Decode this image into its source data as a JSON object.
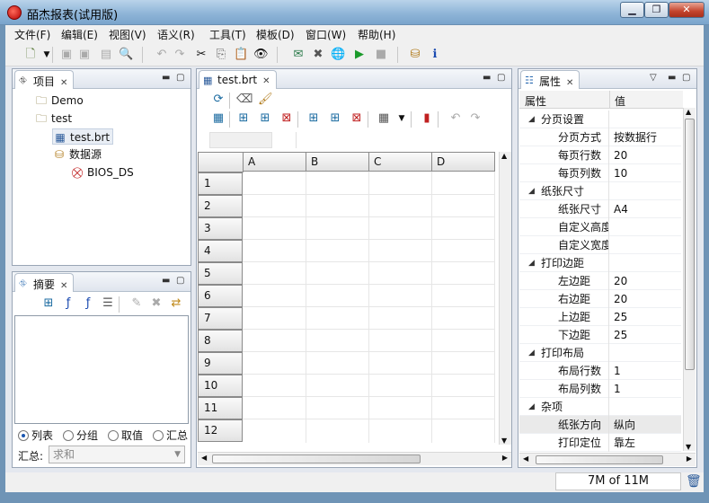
{
  "app": {
    "title": "皕杰报表(试用版)"
  },
  "menu": [
    "文件(F)",
    "编辑(E)",
    "视图(V)",
    "语义(R)",
    "工具(T)",
    "模板(D)",
    "窗口(W)",
    "帮助(H)"
  ],
  "project_panel": {
    "tab": "项目",
    "tree": [
      {
        "label": "Demo",
        "icon": "folder-icon"
      },
      {
        "label": "test",
        "icon": "folder-icon"
      },
      {
        "label": "test.brt",
        "icon": "report-file-icon"
      },
      {
        "label": "数据源",
        "icon": "datasource-icon"
      },
      {
        "label": "BIOS_DS",
        "icon": "db-error-icon"
      }
    ]
  },
  "summary_panel": {
    "tab": "摘要",
    "radios": [
      {
        "label": "列表",
        "checked": true
      },
      {
        "label": "分组",
        "checked": false
      },
      {
        "label": "取值",
        "checked": false
      },
      {
        "label": "汇总",
        "checked": false
      }
    ],
    "agg_label": "汇总:",
    "agg_value": "求和"
  },
  "editor": {
    "tab": "test.brt",
    "columns": [
      "A",
      "B",
      "C",
      "D"
    ],
    "rows": [
      "1",
      "2",
      "3",
      "4",
      "5",
      "6",
      "7",
      "8",
      "9",
      "10",
      "11",
      "12"
    ]
  },
  "properties": {
    "tab": "属性",
    "header_key": "属性",
    "header_value": "值",
    "rows": [
      {
        "key": "分页设置",
        "value": "",
        "category": true
      },
      {
        "key": "分页方式",
        "value": "按数据行",
        "category": false
      },
      {
        "key": "每页行数",
        "value": "20",
        "category": false
      },
      {
        "key": "每页列数",
        "value": "10",
        "category": false
      },
      {
        "key": "纸张尺寸",
        "value": "",
        "category": true
      },
      {
        "key": "纸张尺寸",
        "value": "A4",
        "category": false
      },
      {
        "key": "自定义高度",
        "value": "",
        "category": false
      },
      {
        "key": "自定义宽度",
        "value": "",
        "category": false
      },
      {
        "key": "打印边距",
        "value": "",
        "category": true
      },
      {
        "key": "左边距",
        "value": "20",
        "category": false
      },
      {
        "key": "右边距",
        "value": "20",
        "category": false
      },
      {
        "key": "上边距",
        "value": "25",
        "category": false
      },
      {
        "key": "下边距",
        "value": "25",
        "category": false
      },
      {
        "key": "打印布局",
        "value": "",
        "category": true
      },
      {
        "key": "布局行数",
        "value": "1",
        "category": false
      },
      {
        "key": "布局列数",
        "value": "1",
        "category": false
      },
      {
        "key": "杂项",
        "value": "",
        "category": true
      },
      {
        "key": "纸张方向",
        "value": "纵向",
        "category": false
      },
      {
        "key": "打印定位",
        "value": "靠左",
        "category": false
      }
    ]
  },
  "status": {
    "memory": "7M of 11M"
  }
}
